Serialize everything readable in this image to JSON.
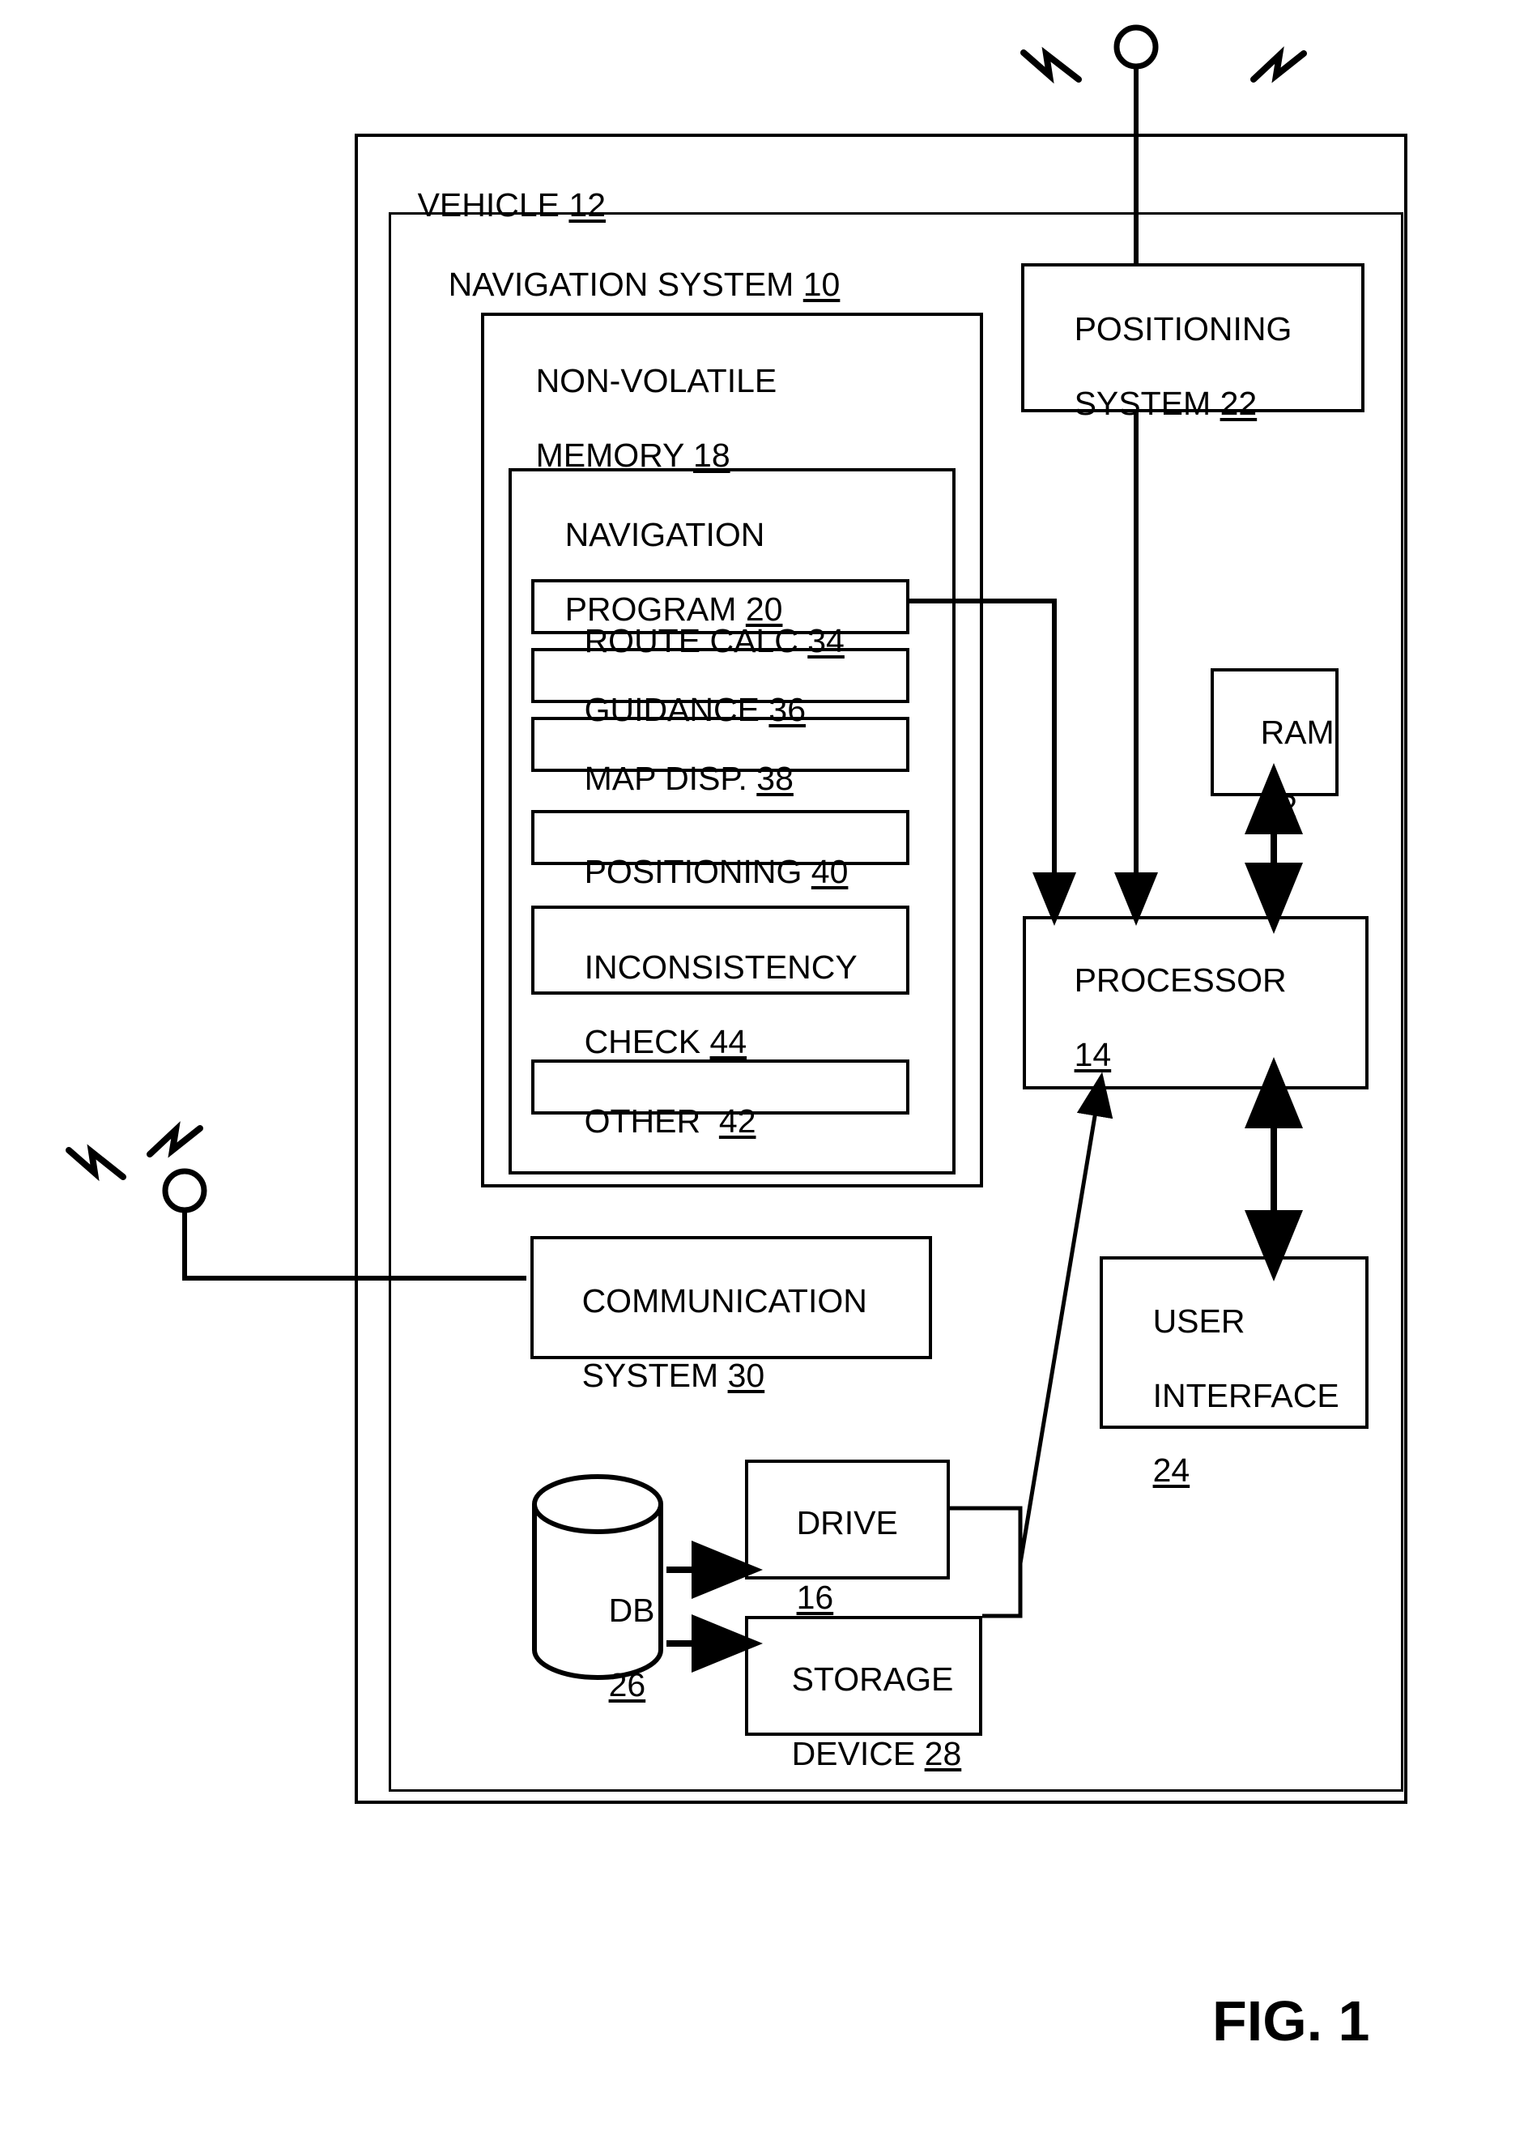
{
  "figure": {
    "caption": "FIG. 1",
    "type": "patent block diagram"
  },
  "outer": {
    "vehicle_label": "VEHICLE",
    "vehicle_ref": "12",
    "nav_system_label": "NAVIGATION SYSTEM",
    "nav_system_ref": "10"
  },
  "memory": {
    "title_line1": "NON-VOLATILE",
    "title_line2": "MEMORY",
    "ref": "18",
    "program": {
      "title_line1": "NAVIGATION",
      "title_line2": "PROGRAM",
      "ref": "20",
      "modules": [
        {
          "label": "ROUTE CALC",
          "ref": "34"
        },
        {
          "label": "GUIDANCE",
          "ref": "36"
        },
        {
          "label": "MAP DISP.",
          "ref": "38"
        },
        {
          "label": "POSITIONING",
          "ref": "40"
        },
        {
          "label_line1": "INCONSISTENCY",
          "label_line2": "CHECK",
          "ref": "44"
        },
        {
          "label": "OTHER ",
          "ref": "42"
        }
      ]
    }
  },
  "blocks": {
    "positioning_system": {
      "line1": "POSITIONING",
      "line2": "SYSTEM",
      "ref": "22"
    },
    "ram": {
      "line1": "RAM",
      "ref": "32"
    },
    "processor": {
      "line1": "PROCESSOR",
      "ref": "14"
    },
    "user_interface": {
      "line1": "USER",
      "line2": "INTERFACE",
      "ref": "24"
    },
    "communication_system": {
      "line1": "COMMUNICATION",
      "line2": "SYSTEM",
      "ref": "30"
    },
    "drive": {
      "line1": "DRIVE",
      "ref": "16"
    },
    "storage_device": {
      "line1": "STORAGE",
      "line2": "DEVICE",
      "ref": "28"
    },
    "database": {
      "line1": "DB",
      "ref": "26"
    }
  },
  "antennas": [
    {
      "name": "top-antenna",
      "desc": "antenna with radio waves connected to positioning system"
    },
    {
      "name": "left-antenna",
      "desc": "antenna with radio waves connected to communication system"
    }
  ],
  "colors": {
    "ink": "#000000",
    "paper": "#ffffff"
  }
}
